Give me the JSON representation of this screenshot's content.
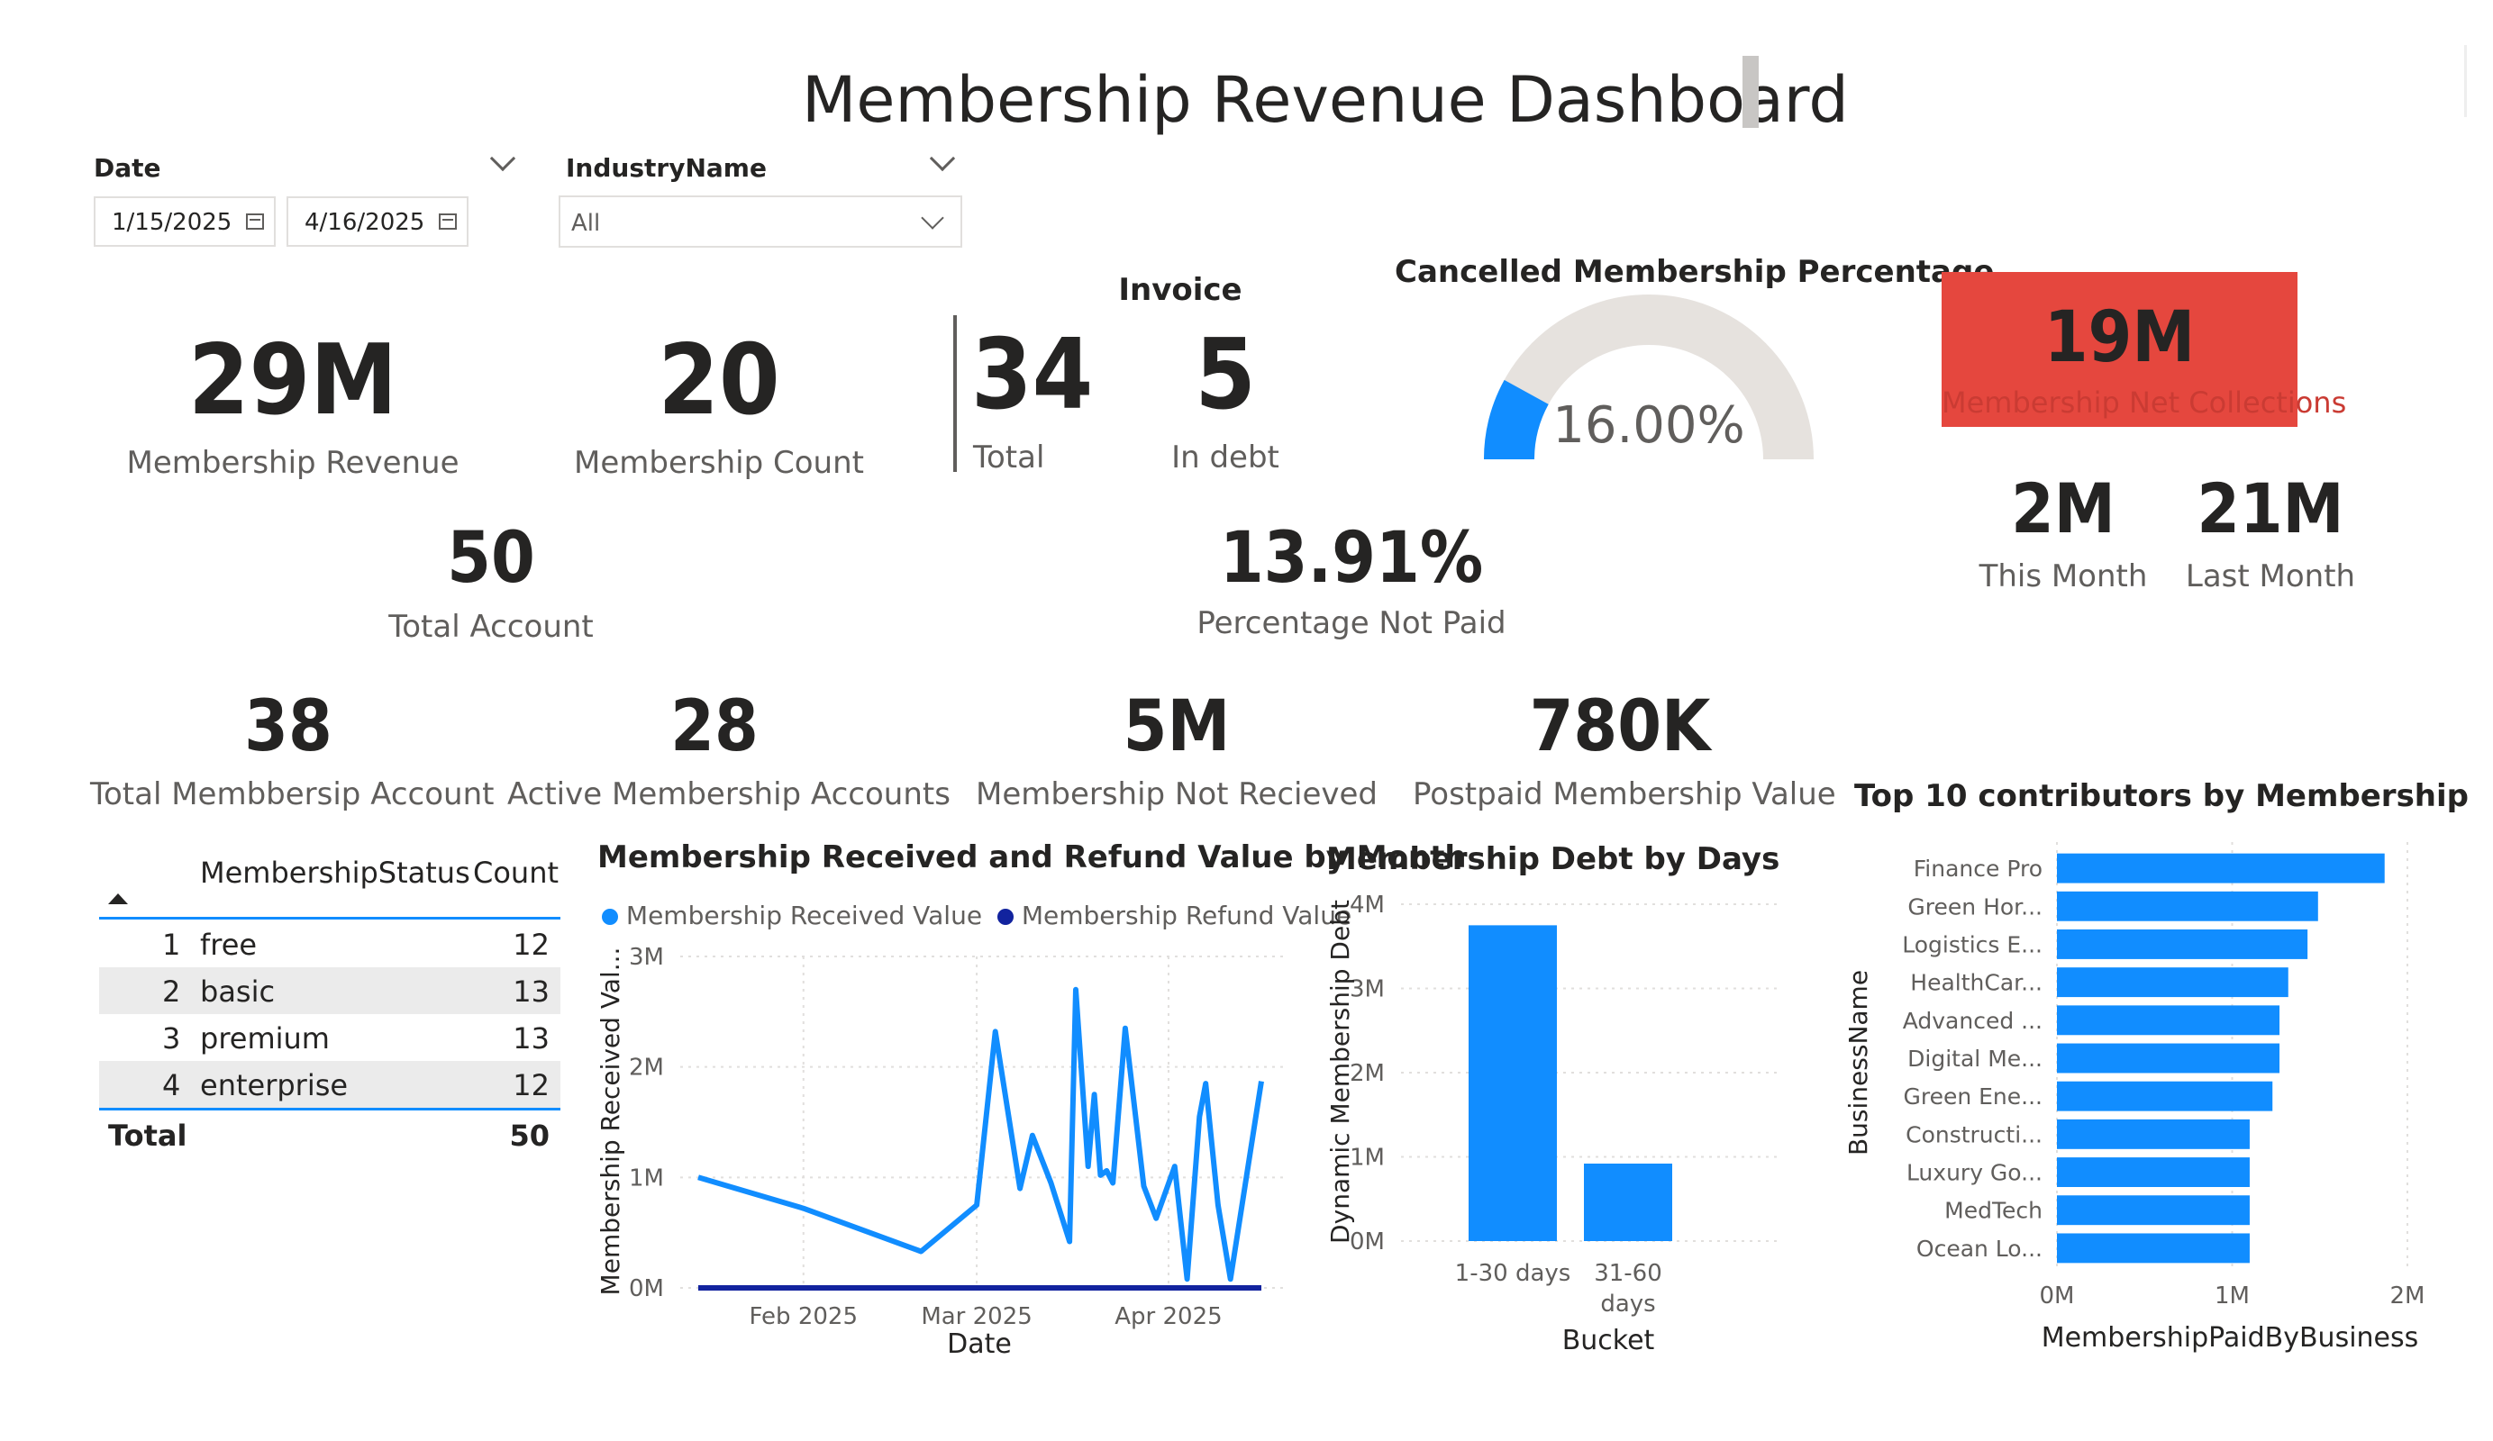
{
  "header": {
    "title": "Membership Revenue Dashboard"
  },
  "slicers": {
    "date": {
      "label": "Date",
      "from": "1/15/2025",
      "to": "4/16/2025"
    },
    "industry": {
      "label": "IndustryName",
      "value": "All"
    }
  },
  "kpis": {
    "membership_revenue": {
      "value": "29M",
      "label": "Membership Revenue"
    },
    "membership_count": {
      "value": "20",
      "label": "Membership Count"
    },
    "invoice": {
      "title": "Invoice",
      "total": {
        "value": "34",
        "label": "Total"
      },
      "in_debt": {
        "value": "5",
        "label": "In debt"
      }
    },
    "total_account": {
      "value": "50",
      "label": "Total Account"
    },
    "percentage_not_paid": {
      "value": "13.91%",
      "label": "Percentage Not Paid"
    },
    "total_membership_account": {
      "value": "38",
      "label": "Total Membbersip Account"
    },
    "active_membership_accounts": {
      "value": "28",
      "label": "Active Membership Accounts"
    },
    "membership_not_received": {
      "value": "5M",
      "label": "Membership Not Recieved"
    },
    "postpaid_membership_value": {
      "value": "780K",
      "label": "Postpaid Membership Value"
    }
  },
  "gauge": {
    "title": "Cancelled Membership Percentage",
    "value_text": "16.00%",
    "value": 0.16,
    "fill_color": "#118dff",
    "track_color": "#e6e2de"
  },
  "net_collections": {
    "value": "19M",
    "label": "Membership Net Collections",
    "bg_color": "#e5473e",
    "this_month": {
      "value": "2M",
      "label": "This Month"
    },
    "last_month": {
      "value": "21M",
      "label": "Last Month"
    }
  },
  "status_table": {
    "headers": [
      "MembershipStatus",
      "Count"
    ],
    "rows": [
      {
        "index": "1",
        "status": "free",
        "count": "12"
      },
      {
        "index": "2",
        "status": "basic",
        "count": "13"
      },
      {
        "index": "3",
        "status": "premium",
        "count": "13"
      },
      {
        "index": "4",
        "status": "enterprise",
        "count": "12"
      }
    ],
    "total_label": "Total",
    "total_value": "50"
  },
  "chart_data": [
    {
      "type": "line",
      "title": "Membership Received and Refund Value by Month",
      "xlabel": "Date",
      "ylabel": "Membership Received Val...",
      "x_ticks": [
        "Feb 2025",
        "Mar 2025",
        "Apr 2025"
      ],
      "y_ticks": [
        "0M",
        "1M",
        "2M",
        "3M"
      ],
      "ylim": [
        0,
        3000000
      ],
      "xlim": [
        "2025-01-15",
        "2025-04-16"
      ],
      "legend_position": "top",
      "series": [
        {
          "name": "Membership Received Value",
          "color": "#118dff",
          "points": [
            [
              "2025-01-15",
              1000000
            ],
            [
              "2025-02-01",
              720000
            ],
            [
              "2025-02-20",
              330000
            ],
            [
              "2025-03-01",
              750000
            ],
            [
              "2025-03-04",
              2320000
            ],
            [
              "2025-03-08",
              900000
            ],
            [
              "2025-03-10",
              1380000
            ],
            [
              "2025-03-13",
              950000
            ],
            [
              "2025-03-16",
              420000
            ],
            [
              "2025-03-17",
              2700000
            ],
            [
              "2025-03-19",
              1100000
            ],
            [
              "2025-03-20",
              1750000
            ],
            [
              "2025-03-21",
              1020000
            ],
            [
              "2025-03-22",
              1060000
            ],
            [
              "2025-03-23",
              950000
            ],
            [
              "2025-03-25",
              2350000
            ],
            [
              "2025-03-28",
              920000
            ],
            [
              "2025-03-30",
              630000
            ],
            [
              "2025-04-02",
              1100000
            ],
            [
              "2025-04-04",
              80000
            ],
            [
              "2025-04-06",
              1550000
            ],
            [
              "2025-04-07",
              1850000
            ],
            [
              "2025-04-09",
              750000
            ],
            [
              "2025-04-11",
              80000
            ],
            [
              "2025-04-16",
              1870000
            ]
          ]
        },
        {
          "name": "Membership Refund Value",
          "color": "#12239e",
          "points": [
            [
              "2025-01-15",
              0
            ],
            [
              "2025-04-16",
              0
            ]
          ]
        }
      ]
    },
    {
      "type": "bar",
      "title": "Membership Debt by Days",
      "xlabel": "Bucket",
      "ylabel": "Dynamic Membership Debt",
      "categories": [
        "1-30 days",
        "31-60 days"
      ],
      "values": [
        3750000,
        920000
      ],
      "y_ticks": [
        "0M",
        "1M",
        "2M",
        "3M",
        "4M"
      ],
      "ylim": [
        0,
        4000000
      ],
      "color": "#118dff"
    },
    {
      "type": "bar",
      "orientation": "horizontal",
      "title": "Top 10 contributors by Membership",
      "xlabel": "MembershipPaidByBusiness",
      "ylabel": "BusinessName",
      "categories": [
        "Finance Pro",
        "Green Hor...",
        "Logistics E...",
        "HealthCar...",
        "Advanced ...",
        "Digital Me...",
        "Green Ene...",
        "Constructi...",
        "Luxury Go...",
        "MedTech",
        "Ocean Lo..."
      ],
      "values": [
        1870000,
        1490000,
        1430000,
        1320000,
        1270000,
        1270000,
        1230000,
        1100000,
        1100000,
        1100000,
        1100000
      ],
      "x_ticks": [
        "0M",
        "1M",
        "2M"
      ],
      "xlim": [
        0,
        2000000
      ],
      "color": "#118dff"
    }
  ]
}
